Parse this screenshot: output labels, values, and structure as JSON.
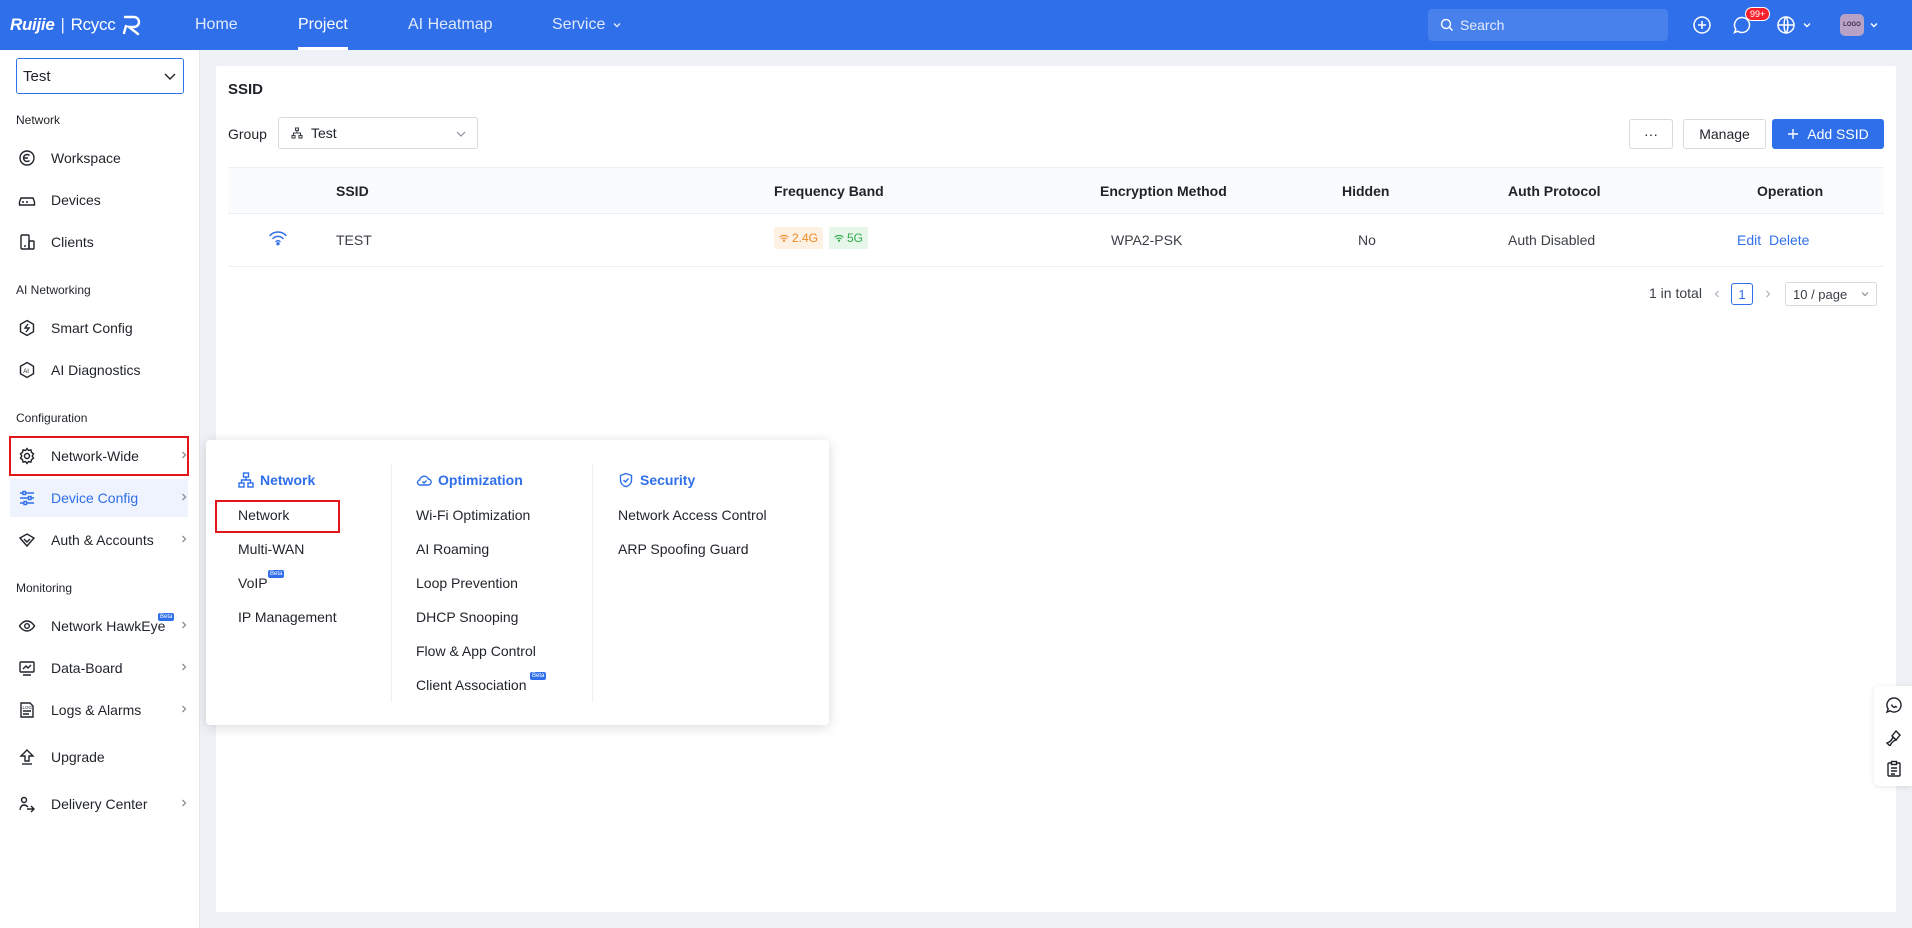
{
  "topbar": {
    "logo_brand": "Ruijie",
    "logo_separator": "|",
    "logo_product": "Rcycc",
    "nav": [
      "Home",
      "Project",
      "AI Heatmap",
      "Service"
    ],
    "active_nav": "Project",
    "search_placeholder": "Search",
    "notification_badge": "99+",
    "avatar_text": "LOGO"
  },
  "sidebar": {
    "project_selected": "Test",
    "sections": {
      "network": "Network",
      "ai_networking": "AI Networking",
      "configuration": "Configuration",
      "monitoring": "Monitoring"
    },
    "items": {
      "workspace": "Workspace",
      "devices": "Devices",
      "clients": "Clients",
      "smart_config": "Smart Config",
      "ai_diagnostics": "AI Diagnostics",
      "network_wide": "Network-Wide",
      "device_config": "Device Config",
      "auth_accounts": "Auth & Accounts",
      "network_hawkeye": "Network HawkEye",
      "data_board": "Data-Board",
      "logs_alarms": "Logs & Alarms",
      "upgrade": "Upgrade",
      "delivery_center": "Delivery Center"
    },
    "beta_label": "Beta"
  },
  "main": {
    "title": "SSID",
    "group_label": "Group",
    "group_selected": "Test",
    "more_button": "···",
    "manage_button": "Manage",
    "add_button": "Add SSID",
    "table": {
      "headers": {
        "ssid": "SSID",
        "frequency_band": "Frequency Band",
        "encryption_method": "Encryption Method",
        "hidden": "Hidden",
        "auth_protocol": "Auth Protocol",
        "operation": "Operation"
      },
      "rows": [
        {
          "ssid": "TEST",
          "band_24": "2.4G",
          "band_5": "5G",
          "encryption": "WPA2-PSK",
          "hidden": "No",
          "auth_protocol": "Auth Disabled",
          "edit": "Edit",
          "delete": "Delete"
        }
      ]
    },
    "pagination": {
      "total": "1 in total",
      "current_page": "1",
      "page_size": "10 / page"
    }
  },
  "popup": {
    "network": {
      "title": "Network",
      "items": [
        "Network",
        "Multi-WAN",
        "VoIP",
        "IP Management"
      ]
    },
    "optimization": {
      "title": "Optimization",
      "items": [
        "Wi-Fi Optimization",
        "AI Roaming",
        "Loop Prevention",
        "DHCP Snooping",
        "Flow & App Control",
        "Client Association"
      ]
    },
    "security": {
      "title": "Security",
      "items": [
        "Network Access Control",
        "ARP Spoofing Guard"
      ]
    },
    "beta_label": "Beta"
  },
  "colors": {
    "primary": "#2f6fea",
    "highlight": "#e0161b",
    "tag_orange": "#f08a24",
    "tag_green": "#2faa4a"
  }
}
